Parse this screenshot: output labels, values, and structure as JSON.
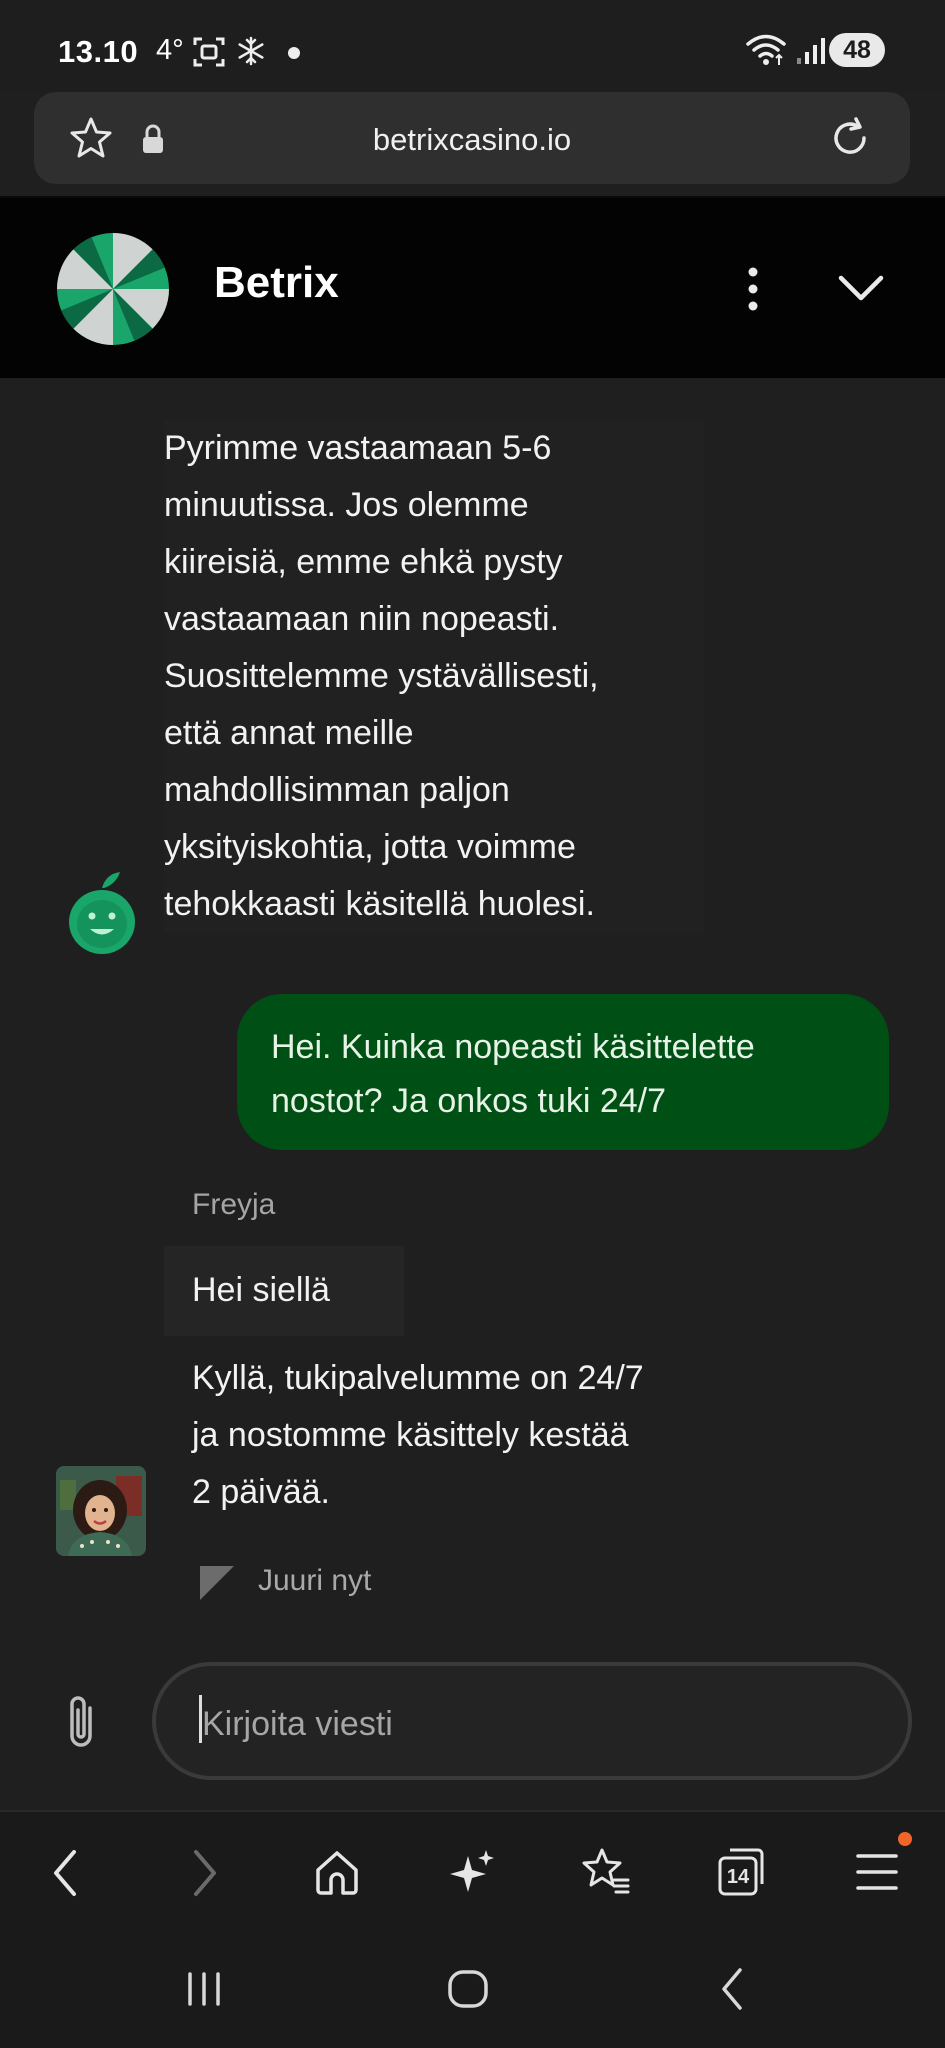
{
  "status_bar": {
    "time": "13.10",
    "temperature": "4°",
    "battery": "48"
  },
  "browser": {
    "url": "betrixcasino.io",
    "tab_count": "14"
  },
  "chat": {
    "brand_name": "Betrix",
    "bot_message": [
      "Pyrimme vastaamaan 5-6",
      "minuutissa. Jos olemme",
      "kiireisiä, emme ehkä pysty",
      "vastaamaan niin nopeasti.",
      "Suosittelemme ystävällisesti,",
      "että annat meille",
      "mahdollisimman paljon",
      "yksityiskohtia, jotta voimme",
      "tehokkaasti käsitellä huolesi."
    ],
    "user_message": [
      "Hei. Kuinka nopeasti käsittelette",
      "nostot? Ja onkos tuki 24/7"
    ],
    "agent_name": "Freyja",
    "agent_message_1": "Hei siellä",
    "agent_message_2": [
      "Kyllä, tukipalvelumme on 24/7",
      "ja nostomme käsittely kestää",
      "2 päivää."
    ],
    "timestamp": "Juuri nyt",
    "composer_placeholder": "Kirjoita viesti"
  },
  "colors": {
    "background": "#1f1f1f",
    "header": "#030303",
    "user_bubble": "#004f14",
    "brand_green": "#1aa66b",
    "notification_dot": "#f0652a"
  }
}
